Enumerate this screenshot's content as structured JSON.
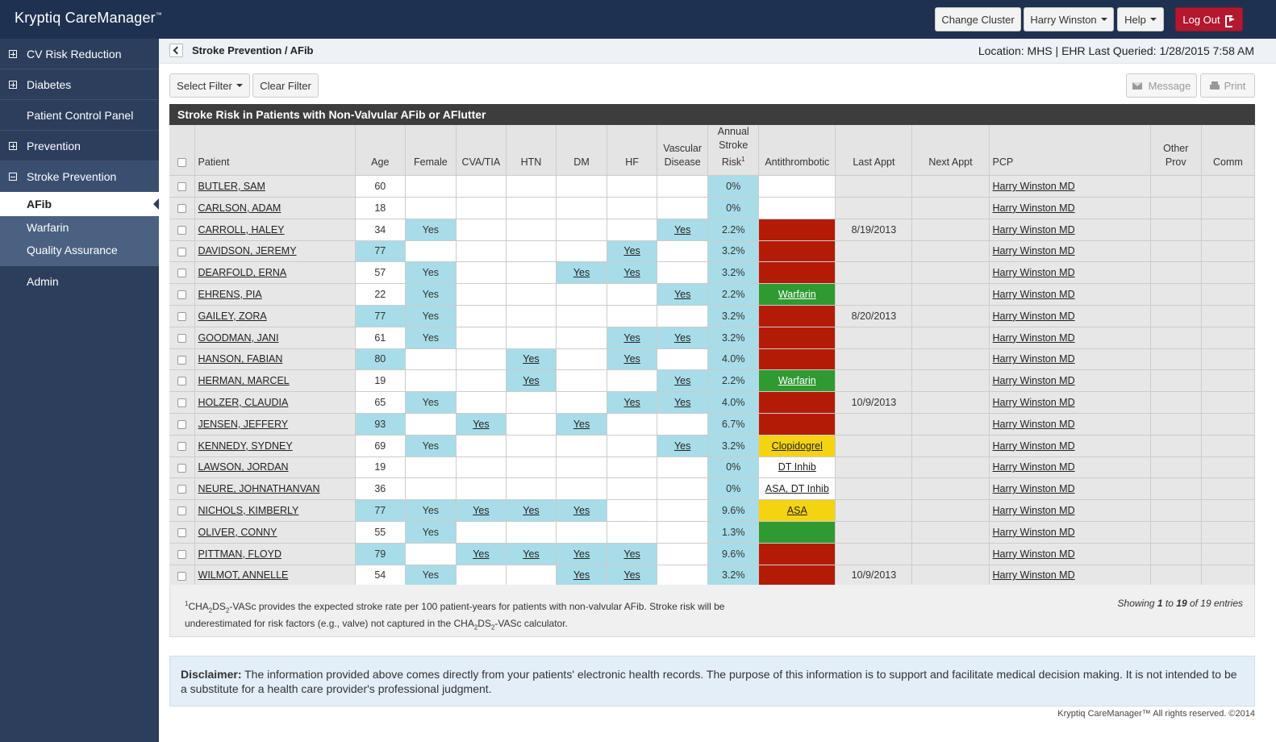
{
  "app": {
    "brand": "Kryptiq CareManager",
    "tm": "™"
  },
  "topbar": {
    "change_cluster": "Change Cluster",
    "user": "Harry Winston",
    "help": "Help",
    "logout": "Log Out"
  },
  "sidebar": {
    "items": [
      {
        "label": "CV Risk Reduction"
      },
      {
        "label": "Diabetes"
      },
      {
        "label": "Patient Control Panel"
      },
      {
        "label": "Prevention"
      },
      {
        "label": "Stroke Prevention"
      }
    ],
    "sub_items": [
      {
        "label": "AFib"
      },
      {
        "label": "Warfarin"
      },
      {
        "label": "Quality Assurance"
      }
    ],
    "admin": "Admin"
  },
  "breadcrumb": "Stroke Prevention / AFib",
  "location": "Location: MHS | EHR Last Queried: 1/28/2015 7:58 AM",
  "toolbar": {
    "select_filter": "Select Filter",
    "clear_filter": "Clear Filter",
    "message": "Message",
    "print": "Print"
  },
  "panel_title": "Stroke Risk in Patients with Non-Valvular AFib or AFlutter",
  "table": {
    "headers": {
      "patient": "Patient",
      "age": "Age",
      "female": "Female",
      "cva": "CVA/TIA",
      "htn": "HTN",
      "dm": "DM",
      "hf": "HF",
      "vascular": "Vascular Disease",
      "risk": "Annual Stroke Risk",
      "risk_sup": "1",
      "antithrombotic": "Antithrombotic",
      "last_appt": "Last Appt",
      "next_appt": "Next Appt",
      "pcp": "PCP",
      "other_prov": "Other Prov",
      "comm": "Comm"
    },
    "rows": [
      {
        "name": "BUTLER, SAM",
        "age": "60",
        "age_hl": false,
        "female": "",
        "cva": "",
        "htn": "",
        "dm": "",
        "hf": "",
        "vasc": "",
        "risk": "0%",
        "anti": "",
        "anti_color": "white",
        "last": "",
        "next": "",
        "pcp": "Harry Winston MD"
      },
      {
        "name": "CARLSON, ADAM",
        "age": "18",
        "age_hl": false,
        "female": "",
        "cva": "",
        "htn": "",
        "dm": "",
        "hf": "",
        "vasc": "",
        "risk": "0%",
        "anti": "",
        "anti_color": "white",
        "last": "",
        "next": "",
        "pcp": "Harry Winston MD"
      },
      {
        "name": "CARROLL, HALEY",
        "age": "34",
        "age_hl": false,
        "female": "Yes",
        "cva": "",
        "htn": "",
        "dm": "",
        "hf": "",
        "vasc": "Yes",
        "risk": "2.2%",
        "anti": "",
        "anti_color": "red",
        "last": "8/19/2013",
        "next": "",
        "pcp": "Harry Winston MD"
      },
      {
        "name": "DAVIDSON, JEREMY",
        "age": "77",
        "age_hl": true,
        "female": "",
        "cva": "",
        "htn": "",
        "dm": "",
        "hf": "Yes",
        "vasc": "",
        "risk": "3.2%",
        "anti": "",
        "anti_color": "red",
        "last": "",
        "next": "",
        "pcp": "Harry Winston MD"
      },
      {
        "name": "DEARFOLD, ERNA",
        "age": "57",
        "age_hl": false,
        "female": "Yes",
        "cva": "",
        "htn": "",
        "dm": "Yes",
        "hf": "Yes",
        "vasc": "",
        "risk": "3.2%",
        "anti": "",
        "anti_color": "red",
        "last": "",
        "next": "",
        "pcp": "Harry Winston MD"
      },
      {
        "name": "EHRENS, PIA",
        "age": "22",
        "age_hl": false,
        "female": "Yes",
        "cva": "",
        "htn": "",
        "dm": "",
        "hf": "",
        "vasc": "Yes",
        "risk": "2.2%",
        "anti": "Warfarin",
        "anti_color": "green",
        "last": "",
        "next": "",
        "pcp": "Harry Winston MD"
      },
      {
        "name": "GAILEY, ZORA",
        "age": "77",
        "age_hl": true,
        "female": "Yes",
        "cva": "",
        "htn": "",
        "dm": "",
        "hf": "",
        "vasc": "",
        "risk": "3.2%",
        "anti": "",
        "anti_color": "red",
        "last": "8/20/2013",
        "next": "",
        "pcp": "Harry Winston MD"
      },
      {
        "name": "GOODMAN, JANI",
        "age": "61",
        "age_hl": false,
        "female": "Yes",
        "cva": "",
        "htn": "",
        "dm": "",
        "hf": "Yes",
        "vasc": "Yes",
        "risk": "3.2%",
        "anti": "",
        "anti_color": "red",
        "last": "",
        "next": "",
        "pcp": "Harry Winston MD"
      },
      {
        "name": "HANSON, FABIAN",
        "age": "80",
        "age_hl": true,
        "female": "",
        "cva": "",
        "htn": "Yes",
        "dm": "",
        "hf": "Yes",
        "vasc": "",
        "risk": "4.0%",
        "anti": "",
        "anti_color": "red",
        "last": "",
        "next": "",
        "pcp": "Harry Winston MD"
      },
      {
        "name": "HERMAN, MARCEL",
        "age": "19",
        "age_hl": false,
        "female": "",
        "cva": "",
        "htn": "Yes",
        "dm": "",
        "hf": "",
        "vasc": "Yes",
        "risk": "2.2%",
        "anti": "Warfarin",
        "anti_color": "green",
        "last": "",
        "next": "",
        "pcp": "Harry Winston MD"
      },
      {
        "name": "HOLZER, CLAUDIA",
        "age": "65",
        "age_hl": false,
        "female": "Yes",
        "cva": "",
        "htn": "",
        "dm": "",
        "hf": "Yes",
        "vasc": "Yes",
        "risk": "4.0%",
        "anti": "",
        "anti_color": "red",
        "last": "10/9/2013",
        "next": "",
        "pcp": "Harry Winston MD"
      },
      {
        "name": "JENSEN, JEFFERY",
        "age": "93",
        "age_hl": true,
        "female": "",
        "cva": "Yes",
        "htn": "",
        "dm": "Yes",
        "hf": "",
        "vasc": "",
        "risk": "6.7%",
        "anti": "",
        "anti_color": "red",
        "last": "",
        "next": "",
        "pcp": "Harry Winston MD"
      },
      {
        "name": "KENNEDY, SYDNEY",
        "age": "69",
        "age_hl": false,
        "female": "Yes",
        "cva": "",
        "htn": "",
        "dm": "",
        "hf": "",
        "vasc": "Yes",
        "risk": "3.2%",
        "anti": "Clopidogrel",
        "anti_color": "yellow",
        "last": "",
        "next": "",
        "pcp": "Harry Winston MD"
      },
      {
        "name": "LAWSON, JORDAN",
        "age": "19",
        "age_hl": false,
        "female": "",
        "cva": "",
        "htn": "",
        "dm": "",
        "hf": "",
        "vasc": "",
        "risk": "0%",
        "anti": "DT Inhib",
        "anti_color": "white",
        "last": "",
        "next": "",
        "pcp": "Harry Winston MD"
      },
      {
        "name": "NEURE, JOHNATHANVAN",
        "age": "36",
        "age_hl": false,
        "female": "",
        "cva": "",
        "htn": "",
        "dm": "",
        "hf": "",
        "vasc": "",
        "risk": "0%",
        "anti": "ASA, DT Inhib",
        "anti_color": "white",
        "last": "",
        "next": "",
        "pcp": "Harry Winston MD"
      },
      {
        "name": "NICHOLS, KIMBERLY",
        "age": "77",
        "age_hl": true,
        "female": "Yes",
        "cva": "Yes",
        "htn": "Yes",
        "dm": "Yes",
        "hf": "",
        "vasc": "",
        "risk": "9.6%",
        "anti": "ASA",
        "anti_color": "yellow",
        "last": "",
        "next": "",
        "pcp": "Harry Winston MD"
      },
      {
        "name": "OLIVER, CONNY",
        "age": "55",
        "age_hl": false,
        "female": "Yes",
        "cva": "",
        "htn": "",
        "dm": "",
        "hf": "",
        "vasc": "",
        "risk": "1.3%",
        "anti": "",
        "anti_color": "green",
        "last": "",
        "next": "",
        "pcp": "Harry Winston MD"
      },
      {
        "name": "PITTMAN, FLOYD",
        "age": "79",
        "age_hl": true,
        "female": "",
        "cva": "Yes",
        "htn": "Yes",
        "dm": "Yes",
        "hf": "Yes",
        "vasc": "",
        "risk": "9.6%",
        "anti": "",
        "anti_color": "red",
        "last": "",
        "next": "",
        "pcp": "Harry Winston MD"
      },
      {
        "name": "WILMOT, ANNELLE",
        "age": "54",
        "age_hl": false,
        "female": "Yes",
        "cva": "",
        "htn": "",
        "dm": "Yes",
        "hf": "Yes",
        "vasc": "",
        "risk": "3.2%",
        "anti": "",
        "anti_color": "red",
        "last": "10/9/2013",
        "next": "",
        "pcp": "Harry Winston MD"
      }
    ]
  },
  "footnote": {
    "sup": "1",
    "text1": "CHA",
    "sub1": "2",
    "text2": "DS",
    "sub2": "2",
    "text3": "-VASc provides the expected stroke rate per 100 patient-years for patients with non-valvular AFib. Stroke risk will be underestimated for risk factors (e.g., valve) not captured in the CHA",
    "sub3": "2",
    "text4": "DS",
    "sub4": "2",
    "text5": "-VASc calculator."
  },
  "entries": {
    "prefix": "Showing ",
    "from": "1",
    "mid": " to ",
    "to": "19",
    "of": " of 19 entries"
  },
  "disclaimer": {
    "label": "Disclaimer:",
    "text": " The information provided above comes directly from your patients' electronic health records. The purpose of this information is to support and facilitate medical decision making. It is not intended to be a substitute for a health care provider's professional judgment."
  },
  "copyright": "Kryptiq CareManager™ All rights reserved. ©2014",
  "colors": {
    "topbar": "#1f3150",
    "sidebar": "#2c3e5c",
    "highlight_blue": "#a8dce8",
    "red": "#b41b07",
    "green": "#2f9a32",
    "yellow": "#f4d411",
    "logout": "#b3182f"
  }
}
